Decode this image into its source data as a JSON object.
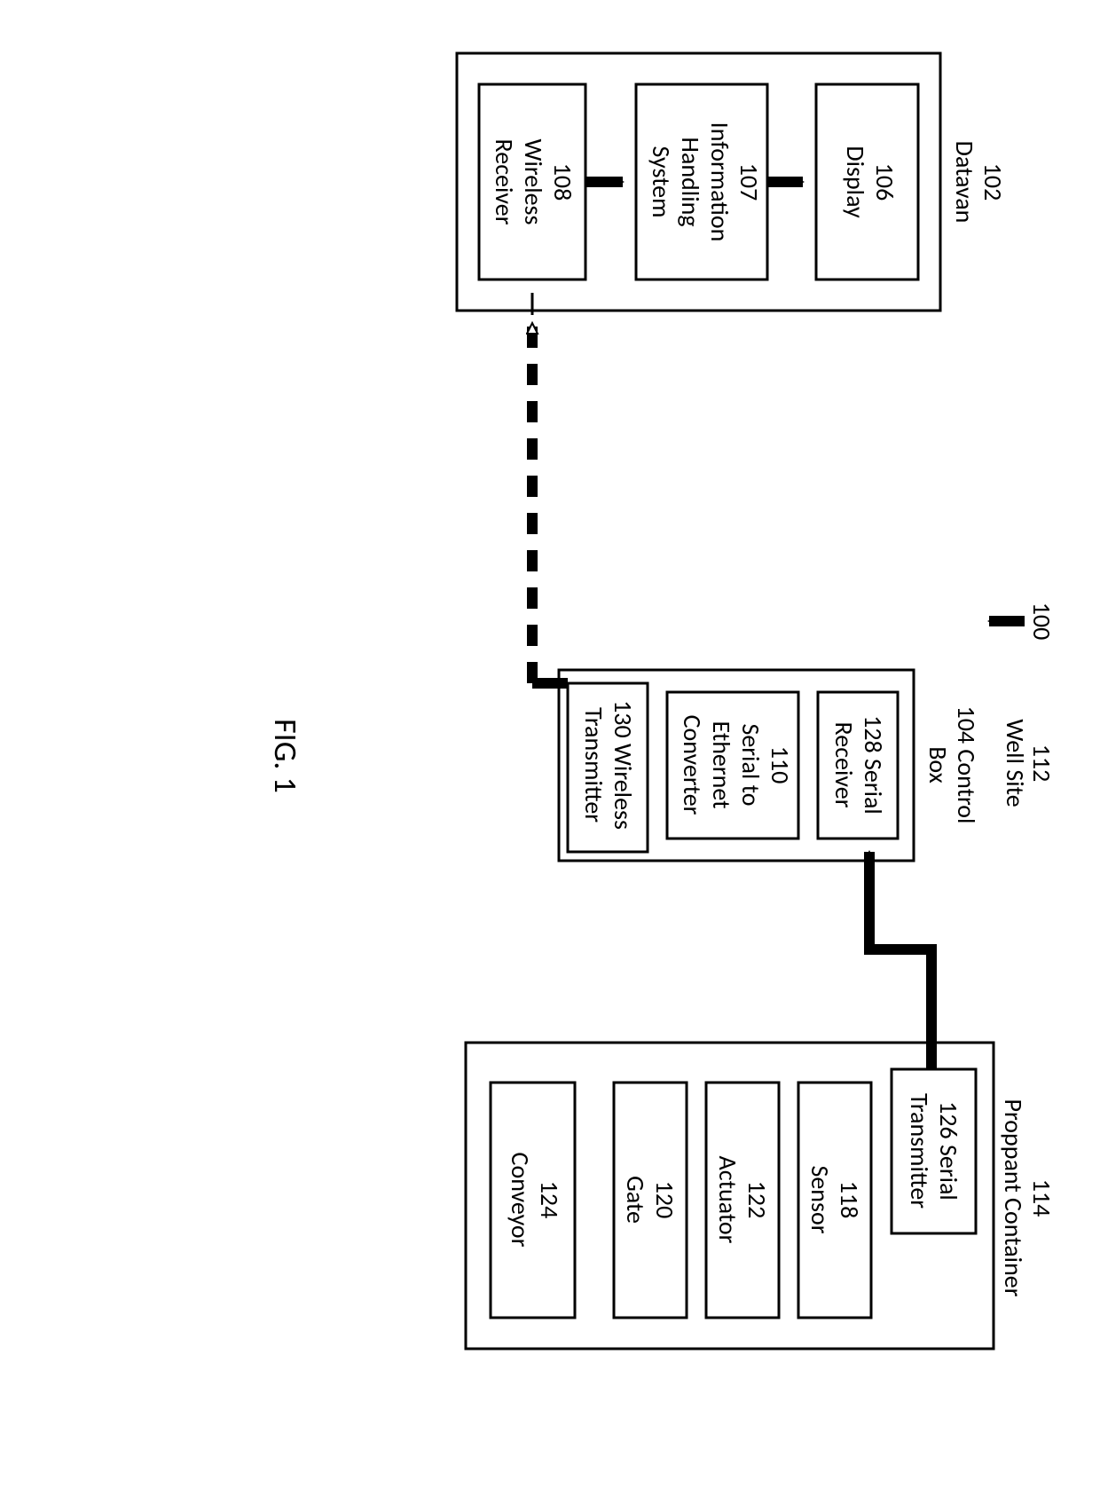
{
  "figure_label": "FIG. 1",
  "system_ref": "100",
  "well_site": {
    "ref": "112",
    "name": "Well Site"
  },
  "datavan": {
    "ref": "102",
    "name": "Datavan",
    "display": {
      "ref": "106",
      "name": "Display"
    },
    "ihs": {
      "ref": "107",
      "name_l1": "Information",
      "name_l2": "Handling",
      "name_l3": "System"
    },
    "wrx": {
      "ref": "108",
      "name_l1": "Wireless",
      "name_l2": "Receiver"
    }
  },
  "control_box": {
    "ref": "104",
    "name_l1": "104 Control",
    "name_l2": "Box",
    "srx": {
      "ref_line": "128 Serial",
      "name": "Receiver"
    },
    "s2e": {
      "ref": "110",
      "l1": "Serial to",
      "l2": "Ethernet",
      "l3": "Converter"
    },
    "wtx": {
      "ref_line": "130 Wireless",
      "name": "Transmitter"
    }
  },
  "proppant": {
    "ref": "114",
    "name": "Proppant Container",
    "stx": {
      "ref_line": "126 Serial",
      "name": "Transmitter"
    },
    "sensor": {
      "ref": "118",
      "name": "Sensor"
    },
    "actuator": {
      "ref": "122",
      "name": "Actuator"
    },
    "gate": {
      "ref": "120",
      "name": "Gate"
    },
    "conveyor": {
      "ref": "124",
      "name": "Conveyor"
    }
  }
}
